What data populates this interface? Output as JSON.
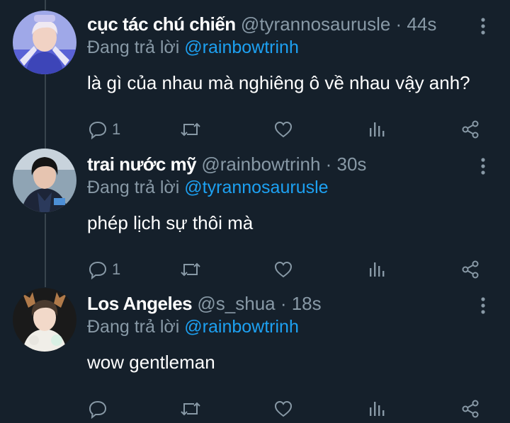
{
  "tweets": [
    {
      "name": "cục tác chú chiến",
      "handle": "@tyrannosaurusle",
      "time": "44s",
      "reply_prefix": "Đang trả lời",
      "reply_to": "@rainbowtrinh",
      "text": "là gì của nhau mà nghiêng ô về nhau vậy anh?",
      "reply_count": "1"
    },
    {
      "name": "trai nước mỹ",
      "handle": "@rainbowtrinh",
      "time": "30s",
      "reply_prefix": "Đang trả lời",
      "reply_to": "@tyrannosaurusle",
      "text": "phép lịch sự thôi mà",
      "reply_count": "1"
    },
    {
      "name": "Los Angeles",
      "handle": "@s_shua",
      "time": "18s",
      "reply_prefix": "Đang trả lời",
      "reply_to": "@rainbowtrinh",
      "text": "wow gentleman",
      "reply_count": ""
    }
  ],
  "separator": " · ",
  "icons": [
    "reply-icon",
    "retweet-icon",
    "like-icon",
    "analytics-icon",
    "share-icon",
    "more-icon"
  ],
  "colors": {
    "background": "#15202b",
    "text": "#ffffff",
    "muted": "#8899a6",
    "link": "#1da1f2",
    "thread_line": "#38444d"
  }
}
